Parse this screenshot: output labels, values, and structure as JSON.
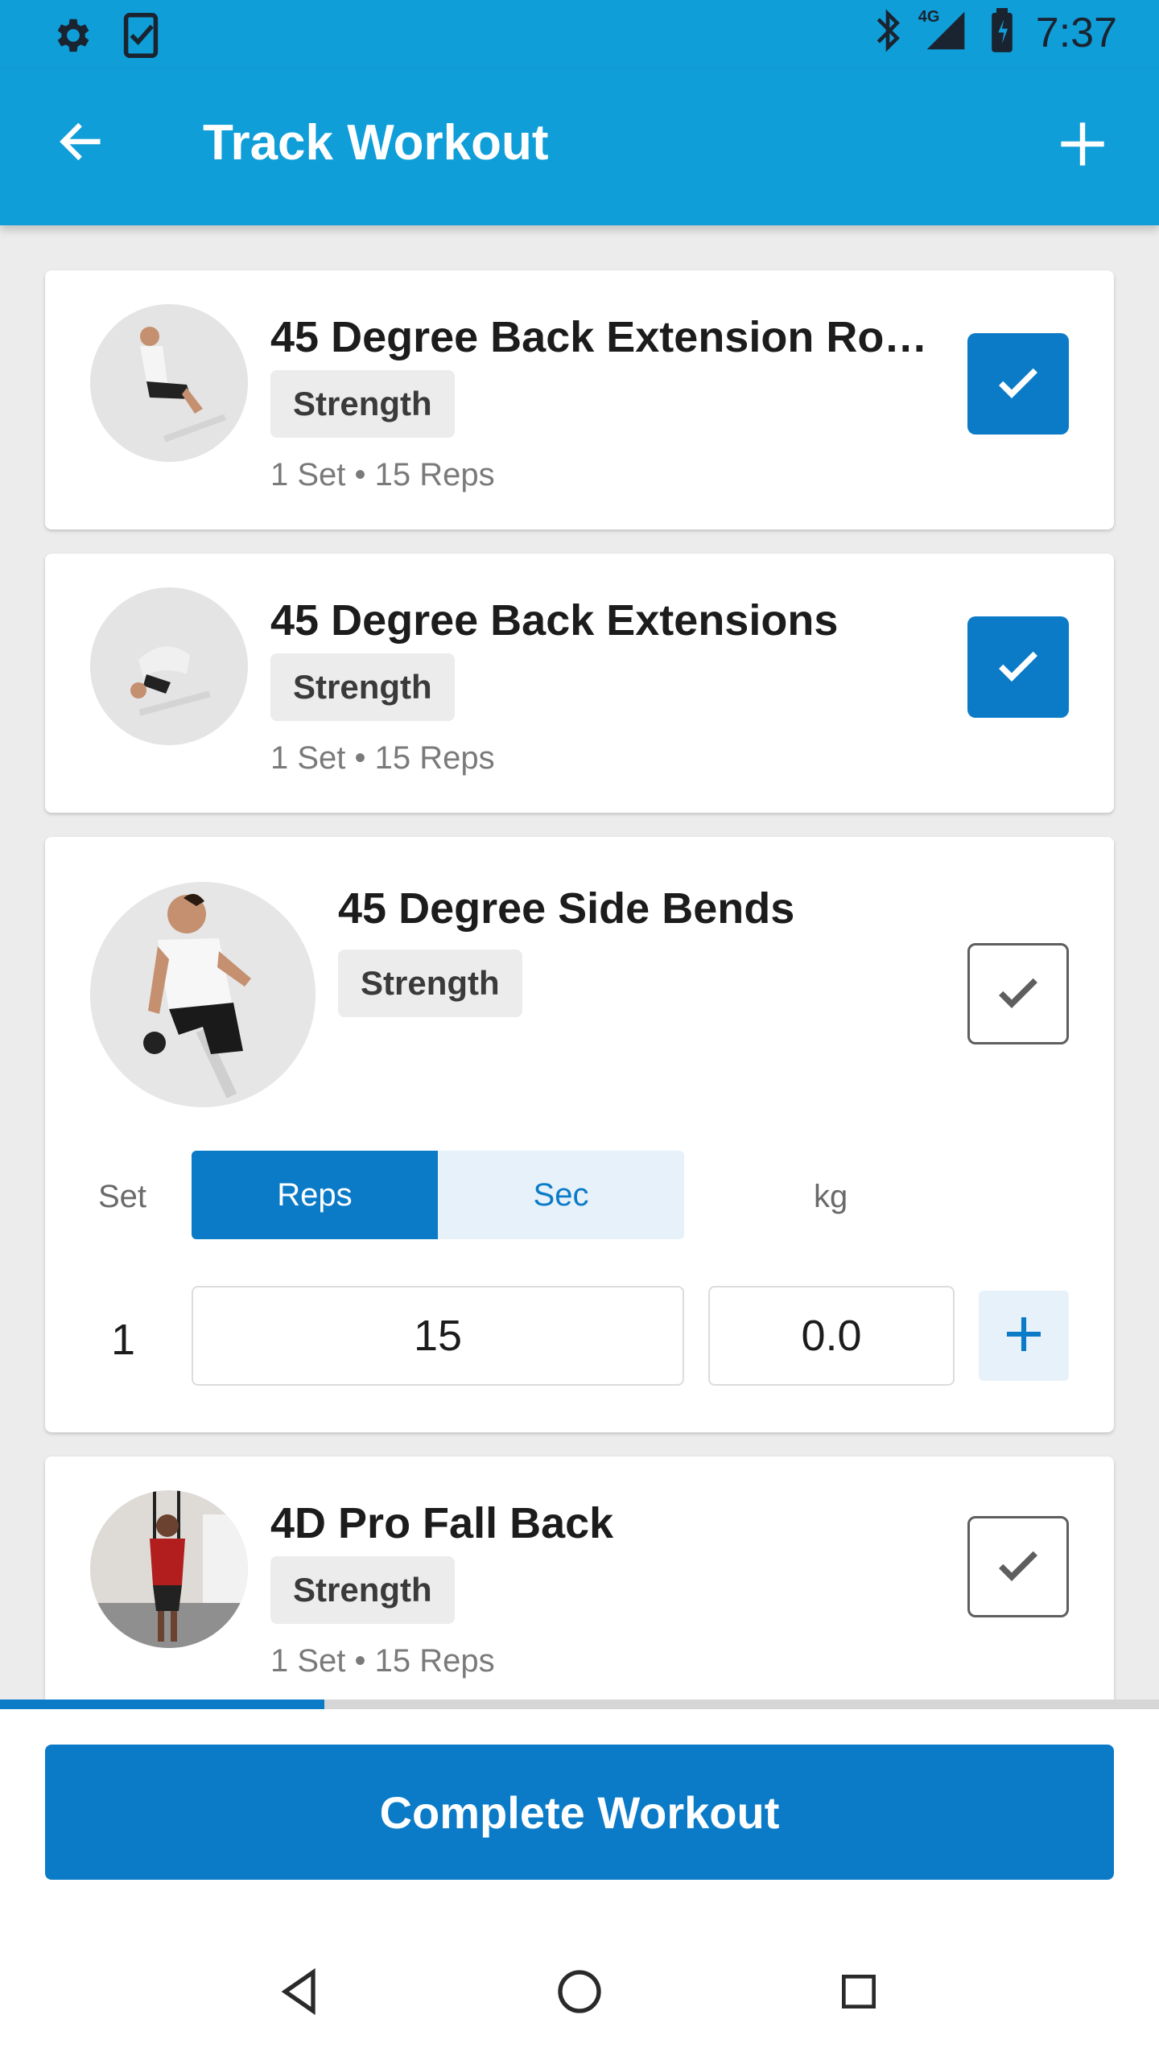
{
  "status_bar": {
    "time": "7:37",
    "network": "4G",
    "icons": [
      "gear-icon",
      "task-check-icon",
      "bluetooth-icon",
      "signal-icon",
      "battery-icon"
    ]
  },
  "app_bar": {
    "title": "Track Workout",
    "back_icon": "arrow-left-icon",
    "add_icon": "plus-icon"
  },
  "exercises": [
    {
      "title": "45 Degree Back Extension Ro…",
      "category": "Strength",
      "summary": "1 Set • 15 Reps",
      "completed": true
    },
    {
      "title": "45 Degree Back Extensions",
      "category": "Strength",
      "summary": "1 Set • 15 Reps",
      "completed": true
    },
    {
      "title": "45 Degree Side Bends",
      "category": "Strength",
      "completed": false,
      "expanded": true,
      "table": {
        "set_label": "Set",
        "mode_options": [
          "Reps",
          "Sec"
        ],
        "selected_mode": "Reps",
        "weight_label": "kg",
        "sets": [
          {
            "number": "1",
            "reps": "15",
            "weight": "0.0"
          }
        ]
      }
    },
    {
      "title": "4D Pro Fall Back",
      "category": "Strength",
      "summary": "1 Set • 15 Reps",
      "completed": false
    }
  ],
  "progress": {
    "fraction": 0.28
  },
  "footer": {
    "complete_label": "Complete Workout"
  },
  "colors": {
    "app_bar": "#109ed9",
    "primary": "#0b7bc8",
    "chip_bg": "#ececec"
  }
}
